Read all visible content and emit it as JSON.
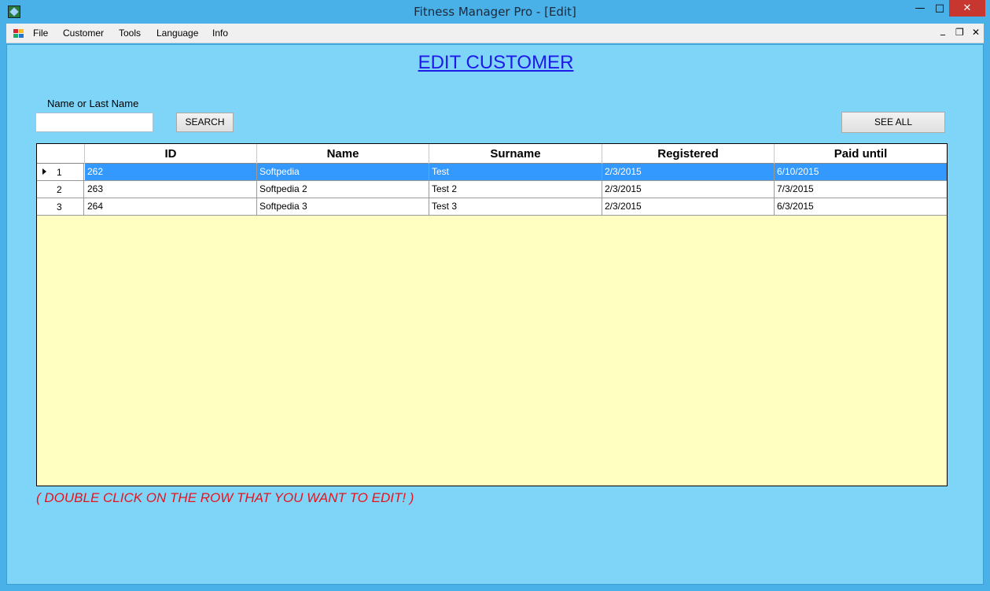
{
  "window": {
    "title": "Fitness Manager Pro - [Edit]",
    "min_glyph": "—",
    "max_glyph": "□",
    "close_glyph": "✕"
  },
  "menu": {
    "items": [
      "File",
      "Customer",
      "Tools",
      "Language",
      "Info"
    ],
    "mdi_min": "_",
    "mdi_restore": "❐",
    "mdi_close": "✕"
  },
  "page": {
    "title": "EDIT CUSTOMER",
    "search_label": "Name or Last Name",
    "search_value": "",
    "search_button": "SEARCH",
    "see_all_button": "SEE ALL",
    "hint": "( DOUBLE CLICK ON THE ROW THAT YOU WANT TO EDIT! )"
  },
  "grid": {
    "columns": [
      "ID",
      "Name",
      "Surname",
      "Registered",
      "Paid until"
    ],
    "rows": [
      {
        "num": "1",
        "cells": [
          "262",
          "Softpedia",
          "Test",
          "2/3/2015",
          "6/10/2015"
        ],
        "selected": true
      },
      {
        "num": "2",
        "cells": [
          "263",
          "Softpedia 2",
          "Test 2",
          "2/3/2015",
          "7/3/2015"
        ],
        "selected": false
      },
      {
        "num": "3",
        "cells": [
          "264",
          "Softpedia 3",
          "Test 3",
          "2/3/2015",
          "6/3/2015"
        ],
        "selected": false
      }
    ]
  },
  "colors": {
    "client_bg": "#7fd5f8",
    "grid_empty_bg": "#ffffc1",
    "selection": "#3399ff",
    "title_link": "#1d19e8",
    "hint_red": "#e6141e"
  }
}
